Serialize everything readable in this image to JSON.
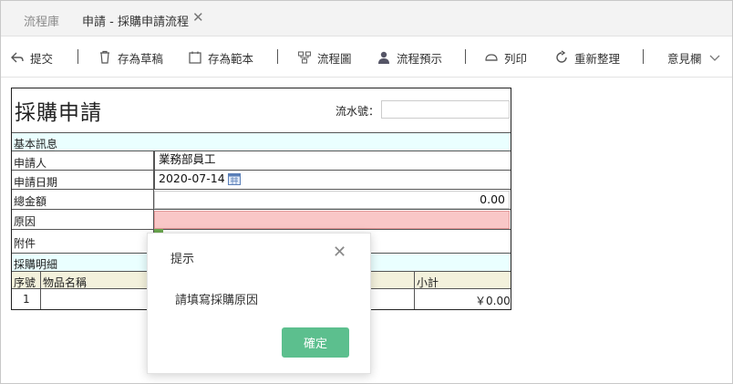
{
  "tabs": {
    "root_label": "流程庫",
    "active_label": "申請 - 採購申請流程",
    "close_glyph": "✕"
  },
  "toolbar": {
    "submit": "提交",
    "save_draft": "存為草稿",
    "save_template": "存為範本",
    "flowchart": "流程圖",
    "flow_preview": "流程預示",
    "print": "列印",
    "refresh": "重新整理",
    "comments": "意見欄"
  },
  "form": {
    "title": "採購申請",
    "serial_label": "流水號：",
    "serial_value": "",
    "section_basic": "基本訊息",
    "applicant_label": "申請人",
    "applicant_value": "業務部員工",
    "date_label": "申請日期",
    "date_value": "2020-07-14",
    "total_label": "總金額",
    "total_value": "0.00",
    "reason_label": "原因",
    "reason_value": "",
    "attachment_label": "附件",
    "section_detail": "採購明細",
    "col_no": "序號",
    "col_item": "物品名稱",
    "col_subtotal": "小計",
    "row1_no": "1",
    "row1_subtotal": "￥0.00"
  },
  "dialog": {
    "title": "提示",
    "close_glyph": "✕",
    "message": "請填寫採購原因",
    "confirm": "確定"
  },
  "colors": {
    "accent_green": "#5cbf8e",
    "error_fill": "#f9c7c7",
    "section_fill": "#eaffff",
    "header_fill": "#f3f1dc"
  }
}
